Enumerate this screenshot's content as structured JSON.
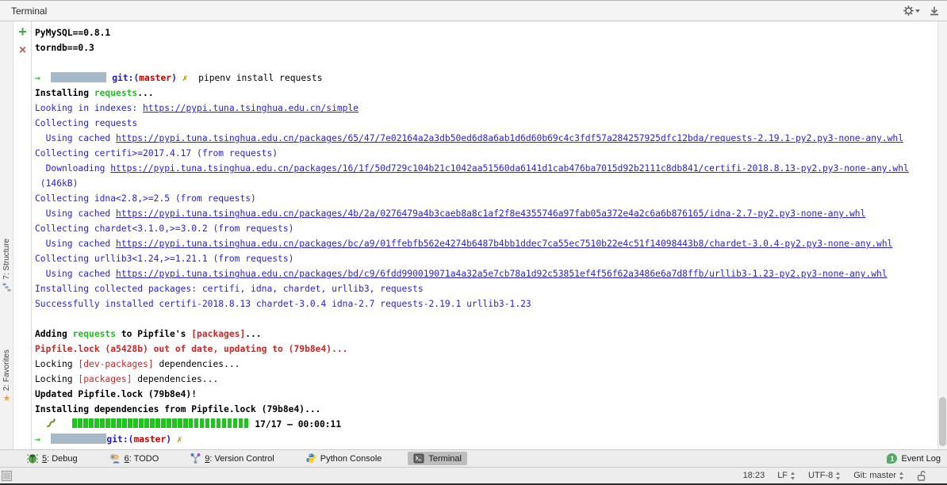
{
  "colors": {
    "blue": "#2a20e0",
    "green": "#1fbf1f",
    "red": "#cb2727",
    "gitblue": "#2017d1",
    "gitred": "#c40000",
    "yellow": "#b58900",
    "progress": "#1dc51d",
    "redacted": "#a7b8c6"
  },
  "panel": {
    "title": "Terminal"
  },
  "header_icons": [
    {
      "name": "gear-icon",
      "dropdown": true
    },
    {
      "name": "hide-icon",
      "dropdown": false
    }
  ],
  "gutter": {
    "add_glyph": "+",
    "close_glyph": "×"
  },
  "left_stripe": {
    "tabs": [
      {
        "label": "7: Structure",
        "icon": "structure-icon"
      },
      {
        "label": "2: Favorites",
        "icon": "star-icon"
      }
    ]
  },
  "terminal": {
    "lines": [
      {
        "segments": [
          {
            "t": "PyMySQL==0.8.1",
            "s": "b"
          }
        ]
      },
      {
        "segments": [
          {
            "t": "torndb==0.3",
            "s": "b"
          }
        ]
      },
      {
        "segments": []
      },
      {
        "segments": [
          {
            "t": "→",
            "s": "arrow"
          },
          {
            "t": "  ",
            "s": "p"
          },
          {
            "icon": "redacted-box"
          },
          {
            "t": " ",
            "s": "p"
          },
          {
            "t": "git:(",
            "s": "gb"
          },
          {
            "t": "master",
            "s": "gr"
          },
          {
            "t": ")",
            "s": "gb"
          },
          {
            "t": " ",
            "s": "p"
          },
          {
            "t": "✗",
            "s": "x"
          },
          {
            "t": "  pipenv install requests",
            "s": "p"
          }
        ]
      },
      {
        "segments": [
          {
            "t": "Installing ",
            "s": "b"
          },
          {
            "t": "requests",
            "s": "g"
          },
          {
            "t": "...",
            "s": "b"
          }
        ]
      },
      {
        "segments": [
          {
            "t": "Looking in indexes: ",
            "s": "bl"
          },
          {
            "t": "https://pypi.tuna.tsinghua.edu.cn/simple",
            "s": "lk"
          }
        ]
      },
      {
        "segments": [
          {
            "t": "Collecting requests",
            "s": "bl"
          }
        ]
      },
      {
        "segments": [
          {
            "t": "  Using cached ",
            "s": "bl"
          },
          {
            "t": "https://pypi.tuna.tsinghua.edu.cn/packages/65/47/7e02164a2a3db50ed6d8a6ab1d6d60b69c4c3fdf57a284257925dfc12bda/requests-2.19.1-py2.py3-none-any.whl",
            "s": "lk"
          }
        ]
      },
      {
        "segments": [
          {
            "t": "Collecting certifi>=2017.4.17 (from requests)",
            "s": "bl"
          }
        ]
      },
      {
        "segments": [
          {
            "t": "  Downloading ",
            "s": "bl"
          },
          {
            "t": "https://pypi.tuna.tsinghua.edu.cn/packages/16/1f/50d729c104b21c1042aa51560da6141d1cab476ba7015d92b2111c8db841/certifi-2018.8.13-py2.py3-none-any.whl",
            "s": "lk"
          }
        ]
      },
      {
        "segments": [
          {
            "t": " (146kB)",
            "s": "bl"
          }
        ]
      },
      {
        "segments": [
          {
            "t": "Collecting idna<2.8,>=2.5 (from requests)",
            "s": "bl"
          }
        ]
      },
      {
        "segments": [
          {
            "t": "  Using cached ",
            "s": "bl"
          },
          {
            "t": "https://pypi.tuna.tsinghua.edu.cn/packages/4b/2a/0276479a4b3caeb8a8c1af2f8e4355746a97fab05a372e4a2c6a6b876165/idna-2.7-py2.py3-none-any.whl",
            "s": "lk"
          }
        ]
      },
      {
        "segments": [
          {
            "t": "Collecting chardet<3.1.0,>=3.0.2 (from requests)",
            "s": "bl"
          }
        ]
      },
      {
        "segments": [
          {
            "t": "  Using cached ",
            "s": "bl"
          },
          {
            "t": "https://pypi.tuna.tsinghua.edu.cn/packages/bc/a9/01ffebfb562e4274b6487b4bb1ddec7ca55ec7510b22e4c51f14098443b8/chardet-3.0.4-py2.py3-none-any.whl",
            "s": "lk"
          }
        ]
      },
      {
        "segments": [
          {
            "t": "Collecting urllib3<1.24,>=1.21.1 (from requests)",
            "s": "bl"
          }
        ]
      },
      {
        "segments": [
          {
            "t": "  Using cached ",
            "s": "bl"
          },
          {
            "t": "https://pypi.tuna.tsinghua.edu.cn/packages/bd/c9/6fdd990019071a4a32a5e7cb78a1d92c53851ef4f56f62a3486e6a7d8ffb/urllib3-1.23-py2.py3-none-any.whl",
            "s": "lk"
          }
        ]
      },
      {
        "segments": [
          {
            "t": "Installing collected packages: certifi, idna, chardet, urllib3, requests",
            "s": "bl"
          }
        ]
      },
      {
        "segments": [
          {
            "t": "Successfully installed certifi-2018.8.13 chardet-3.0.4 idna-2.7 requests-2.19.1 urllib3-1.23",
            "s": "bl"
          }
        ]
      },
      {
        "segments": []
      },
      {
        "segments": [
          {
            "t": "Adding ",
            "s": "b"
          },
          {
            "t": "requests",
            "s": "g"
          },
          {
            "t": " to Pipfile's ",
            "s": "b"
          },
          {
            "t": "[packages]",
            "s": "rb"
          },
          {
            "t": "...",
            "s": "b"
          }
        ]
      },
      {
        "segments": [
          {
            "t": "Pipfile.lock (a5428b) out of date, updating to (79b8e4)...",
            "s": "rb"
          }
        ]
      },
      {
        "segments": [
          {
            "t": "Locking ",
            "s": "p"
          },
          {
            "t": "[dev-packages]",
            "s": "r"
          },
          {
            "t": " dependencies...",
            "s": "p"
          }
        ]
      },
      {
        "segments": [
          {
            "t": "Locking ",
            "s": "p"
          },
          {
            "t": "[packages]",
            "s": "r"
          },
          {
            "t": " dependencies...",
            "s": "p"
          }
        ]
      },
      {
        "segments": [
          {
            "t": "Updated Pipfile.lock (79b8e4)!",
            "s": "b"
          }
        ]
      },
      {
        "segments": [
          {
            "t": "Installing dependencies from Pipfile.lock (79b8e4)...",
            "s": "b"
          }
        ]
      },
      {
        "segments": [
          {
            "t": "  ",
            "s": "p"
          },
          {
            "icon": "snake"
          },
          {
            "t": "   ",
            "s": "p"
          },
          {
            "icon": "progress-bar",
            "n": 32
          },
          {
            "t": " ",
            "s": "p"
          },
          {
            "t": "17/17 — 00:00:11",
            "s": "b"
          }
        ]
      },
      {
        "segments": [
          {
            "t": "→",
            "s": "arrow"
          },
          {
            "t": "  ",
            "s": "p"
          },
          {
            "icon": "redacted-box"
          },
          {
            "t": "git:(",
            "s": "gb"
          },
          {
            "t": "master",
            "s": "gr"
          },
          {
            "t": ")",
            "s": "gb"
          },
          {
            "t": " ",
            "s": "p"
          },
          {
            "t": "✗",
            "s": "x"
          }
        ]
      }
    ]
  },
  "bottom_bar": {
    "tabs": [
      {
        "label": "5: Debug",
        "mnemonic": "5",
        "icon": "debug-icon",
        "active": false
      },
      {
        "label": "6: TODO",
        "mnemonic": "6",
        "icon": "todo-icon",
        "active": false
      },
      {
        "label": "9: Version Control",
        "mnemonic": "9",
        "icon": "version-control-icon",
        "active": false
      },
      {
        "label": "Python Console",
        "mnemonic": "",
        "icon": "python-icon",
        "active": false
      },
      {
        "label": "Terminal",
        "mnemonic": "",
        "icon": "terminal-icon",
        "active": true
      }
    ],
    "event_log": {
      "badge": "1",
      "label": "Event Log"
    }
  },
  "status_bar": {
    "items": [
      {
        "label": "18:23",
        "dropdown": false
      },
      {
        "label": "LF",
        "dropdown": true
      },
      {
        "label": "UTF-8",
        "dropdown": true
      },
      {
        "label": "Git: master",
        "dropdown": true
      },
      {
        "icon": "unlock-icon"
      }
    ]
  }
}
